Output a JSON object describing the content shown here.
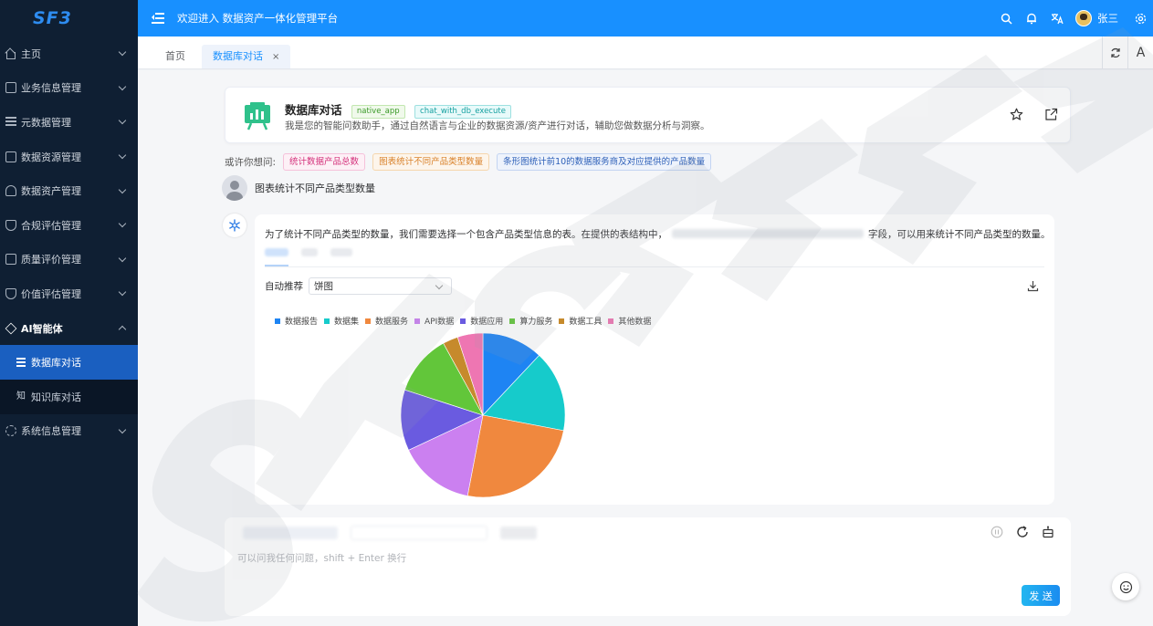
{
  "sidebar": {
    "logo": "SF3",
    "menu": [
      {
        "label": "主页",
        "icon": "home-icon"
      },
      {
        "label": "业务信息管理",
        "icon": "business-info-icon"
      },
      {
        "label": "元数据管理",
        "icon": "metadata-icon"
      },
      {
        "label": "数据资源管理",
        "icon": "data-resource-icon"
      },
      {
        "label": "数据资产管理",
        "icon": "data-asset-icon"
      },
      {
        "label": "合规评估管理",
        "icon": "shield-check-icon"
      },
      {
        "label": "质量评价管理",
        "icon": "quality-icon"
      },
      {
        "label": "价值评估管理",
        "icon": "value-shield-icon"
      },
      {
        "label": "AI智能体",
        "icon": "ai-agent-icon"
      },
      {
        "label": "系统信息管理",
        "icon": "gear-icon"
      }
    ],
    "submenu": [
      {
        "label": "数据库对话",
        "icon": "database-icon",
        "active": true
      },
      {
        "label": "知识库对话",
        "icon": "knowledge-icon",
        "icon_glyph": "知",
        "active": false
      }
    ]
  },
  "header": {
    "welcome": "欢迎进入 数据资产一体化管理平台",
    "username": "张三"
  },
  "tabs": [
    {
      "label": "首页",
      "active": false
    },
    {
      "label": "数据库对话",
      "active": true,
      "close": "×"
    }
  ],
  "tabs_right": {
    "toolbar_letter": "A"
  },
  "agent": {
    "title": "数据库对话",
    "tags": [
      "native_app",
      "chat_with_db_execute"
    ],
    "description": "我是您的智能问数助手，通过自然语言与企业的数据资源/资产进行对话，辅助您做数据分析与洞察。"
  },
  "suggestions": {
    "label": "或许你想问:",
    "items": [
      "统计数据产品总数",
      "图表统计不同产品类型数量",
      "条形图统计前10的数据服务商及对应提供的产品数量"
    ]
  },
  "user_message": "图表统计不同产品类型数量",
  "answer": {
    "text_before": "为了统计不同产品类型的数量，我们需要选择一个包含产品类型信息的表。在提供的表结构中，",
    "text_after": "字段，可以用来统计不同产品类型的数量。",
    "recommend_label": "自动推荐",
    "chart_select": "饼图"
  },
  "chart_data": {
    "type": "pie",
    "title": "",
    "series": [
      {
        "name": "数据报告",
        "value": 12,
        "color": "#1e84f3"
      },
      {
        "name": "数据集",
        "value": 16,
        "color": "#16cbcb"
      },
      {
        "name": "数据服务",
        "value": 25,
        "color": "#f0883e"
      },
      {
        "name": "API数据",
        "value": 15,
        "color": "#cb80f0"
      },
      {
        "name": "数据应用",
        "value": 12,
        "color": "#6a5be0"
      },
      {
        "name": "算力服务",
        "value": 12,
        "color": "#62c63a"
      },
      {
        "name": "数据工具",
        "value": 3,
        "color": "#c68a2c"
      },
      {
        "name": "其他数据",
        "value": 5,
        "color": "#ee76b2"
      }
    ],
    "legend_position": "top-left"
  },
  "input": {
    "placeholder": "可以问我任何问题，shift + Enter 换行",
    "send_label": "发 送"
  },
  "colors": {
    "header_blue": "#1890ff",
    "sidebar_bg": "#0f1f33",
    "active_menu": "#1a5fc0"
  }
}
